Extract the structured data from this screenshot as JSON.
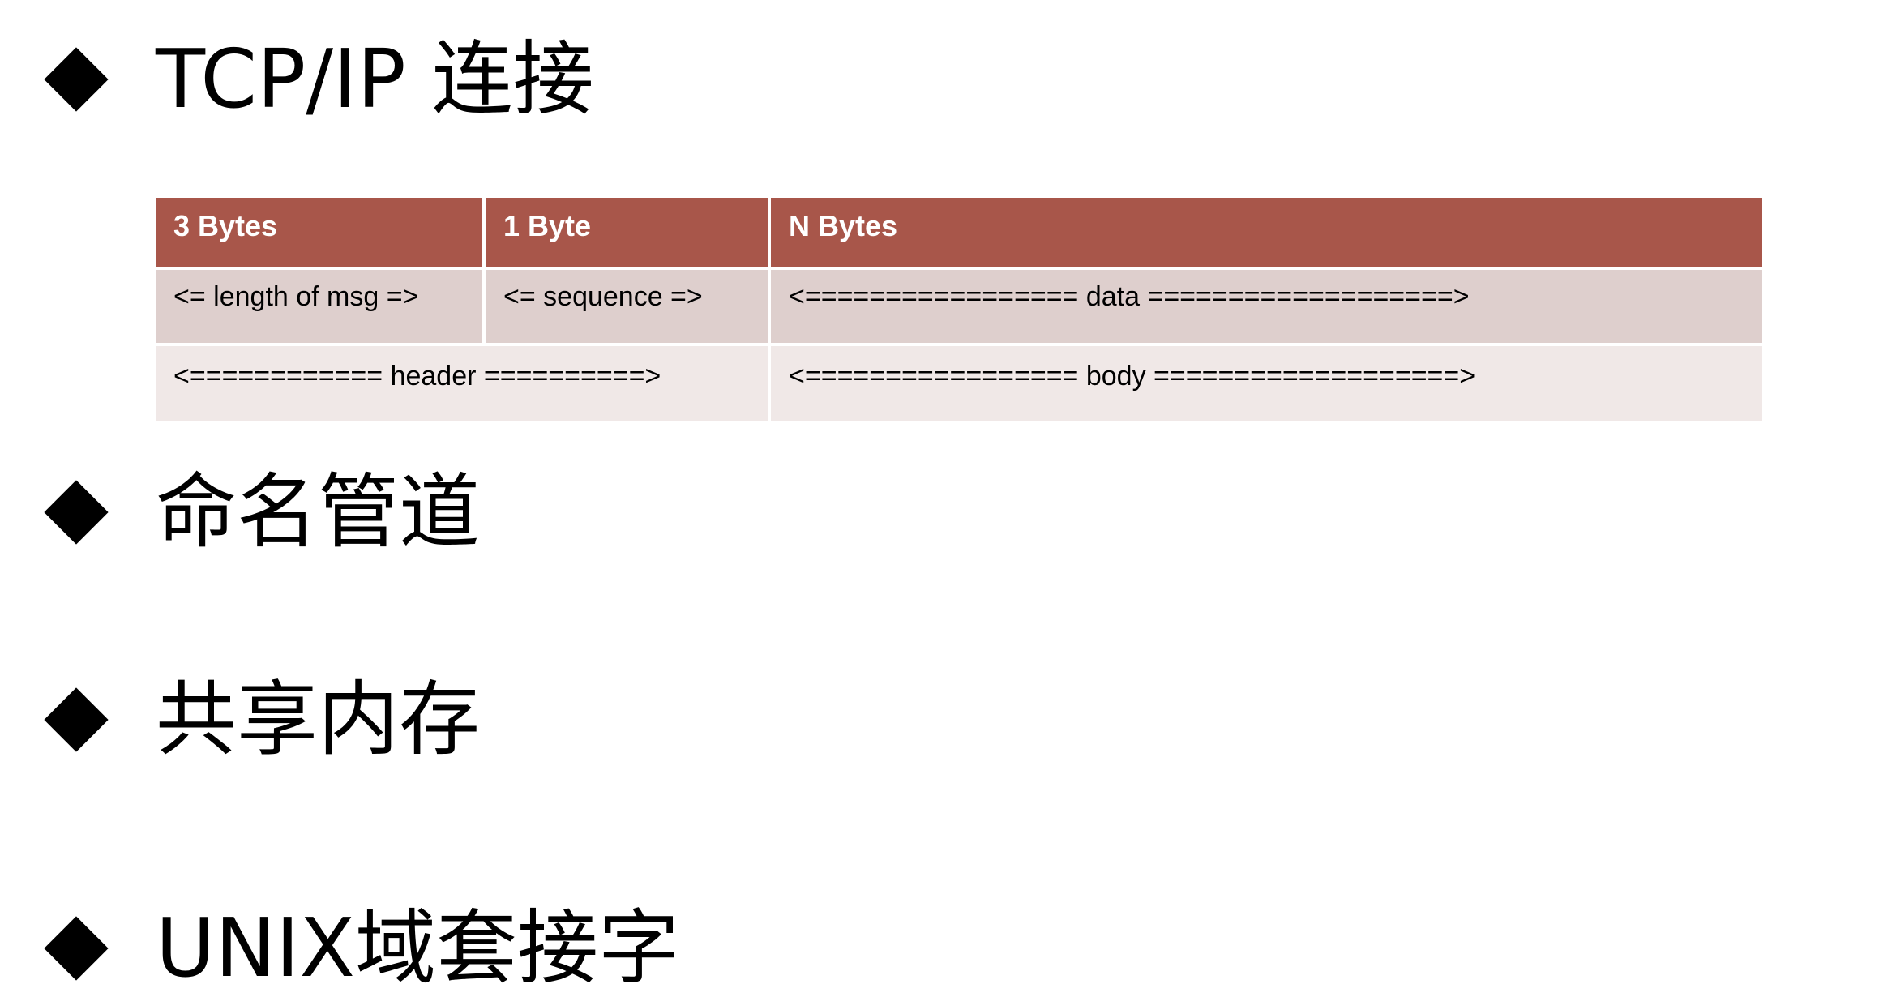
{
  "headings": [
    "TCP/IP 连接",
    "命名管道",
    "共享内存",
    "UNIX域套接字"
  ],
  "table": {
    "header": [
      "3 Bytes",
      "1 Byte",
      "N Bytes"
    ],
    "row1": [
      "<= length of msg =>",
      "<= sequence =>",
      "<================= data ===================>"
    ],
    "row2": [
      "<============ header ==========>",
      "<================= body ===================>"
    ]
  },
  "colors": {
    "header_bg": "#a8564a",
    "row1_bg": "#decfcd",
    "row2_bg": "#f0e8e7"
  }
}
